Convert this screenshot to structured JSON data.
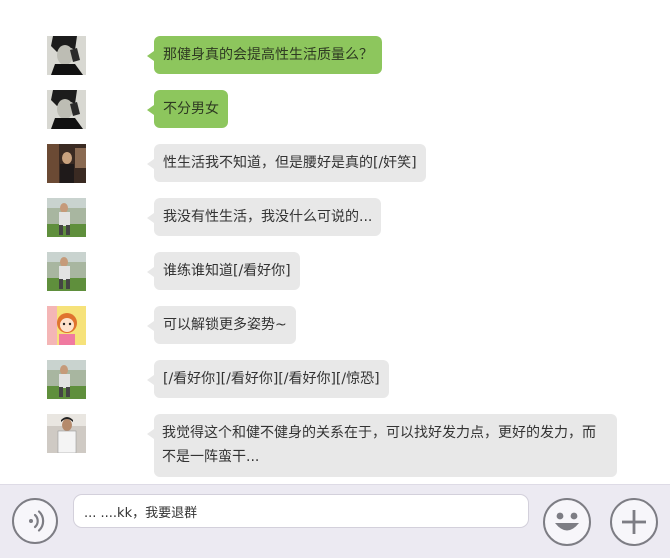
{
  "messages": [
    {
      "sender": "me",
      "avatar": "boy-portrait-bw",
      "text": "那健身真的会提高性生活质量么？"
    },
    {
      "sender": "me",
      "avatar": "boy-portrait-bw",
      "text": "不分男女"
    },
    {
      "sender": "other",
      "avatar": "person-dark-photo",
      "text": "性生活我不知道，但是腰好是真的[/奸笑]"
    },
    {
      "sender": "other",
      "avatar": "person-outdoor-green",
      "text": "我没有性生活，我没什么可说的..."
    },
    {
      "sender": "other",
      "avatar": "person-outdoor-green",
      "text": "谁练谁知道[/看好你]"
    },
    {
      "sender": "other",
      "avatar": "cartoon-girl-yellow",
      "text": "可以解锁更多姿势~"
    },
    {
      "sender": "other",
      "avatar": "person-outdoor-green",
      "text": "[/看好你][/看好你][/看好你][/惊恐]"
    },
    {
      "sender": "other",
      "avatar": "man-white-shirt",
      "text": "我觉得这个和健不健身的关系在于，可以找好发力点，更好的发力，而不是一阵蛮干..."
    }
  ],
  "input": {
    "value": "... ....kk，我要退群"
  },
  "icons": {
    "voice": "voice-icon",
    "emoji": "emoji-smile-icon",
    "plus": "plus-icon"
  },
  "colors": {
    "my_bubble": "#8dc65d",
    "other_bubble": "#e8e8e8",
    "input_bar": "#eceaf2"
  }
}
